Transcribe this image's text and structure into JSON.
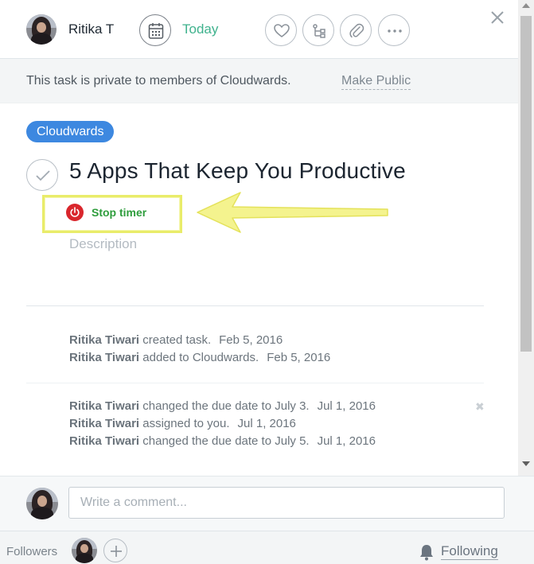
{
  "header": {
    "assignee_name": "Ritika T",
    "due_label": "Today",
    "icons": {
      "due": "calendar-icon",
      "like": "heart-icon",
      "subtask": "subtask-icon",
      "attach": "paperclip-icon",
      "more": "more-icon",
      "close": "close-icon"
    }
  },
  "banner": {
    "text": "This task is private to members of Cloudwards.",
    "make_public": "Make Public"
  },
  "task": {
    "project": "Cloudwards",
    "title": "5 Apps That Keep You Productive",
    "timer_label": "Stop timer",
    "description_placeholder": "Description"
  },
  "stories": [
    {
      "user": "Ritika Tiwari",
      "action": " created task.",
      "date": "Feb 5, 2016"
    },
    {
      "user": "Ritika Tiwari",
      "action": " added to Cloudwards.",
      "date": "Feb 5, 2016"
    },
    {
      "user": "Ritika Tiwari",
      "action": " changed the due date to July 3.",
      "date": "Jul 1, 2016"
    },
    {
      "user": "Ritika Tiwari",
      "action": " assigned to you.",
      "date": "Jul 1, 2016"
    },
    {
      "user": "Ritika Tiwari",
      "action": " changed the due date to July 5.",
      "date": "Jul 1, 2016"
    }
  ],
  "composer": {
    "placeholder": "Write a comment..."
  },
  "followers": {
    "label": "Followers",
    "following_label": "Following"
  },
  "colors": {
    "accent_green": "#3fb28d",
    "project_tag": "#3d88e0",
    "timer_red": "#d9262c",
    "timer_text": "#2e9d3c",
    "highlight": "#e9ec6a"
  }
}
